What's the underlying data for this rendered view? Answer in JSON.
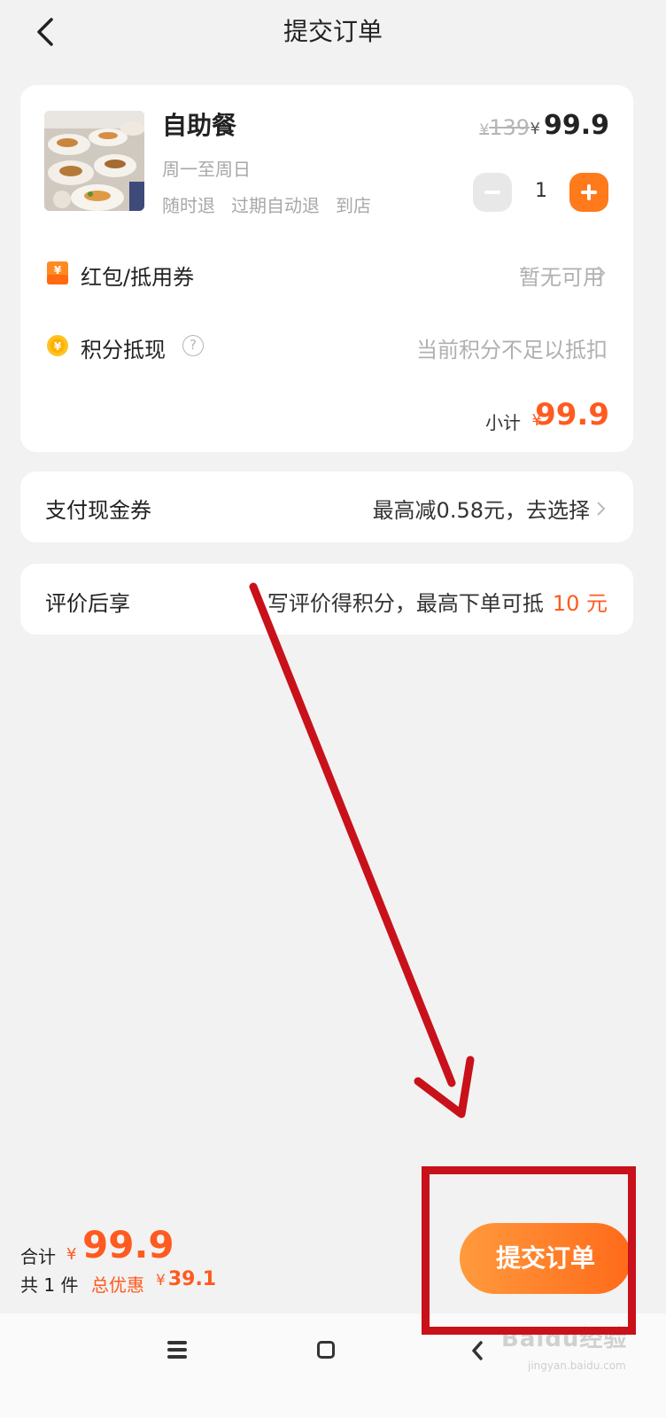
{
  "header": {
    "title": "提交订单",
    "back_icon": "chevron-left-icon"
  },
  "product": {
    "name": "自助餐",
    "days": "周一至周日",
    "tags": [
      "随时退",
      "过期自动退",
      "到店"
    ],
    "currency": "¥",
    "original_price": "139",
    "price": "99.9",
    "quantity": "1"
  },
  "coupon_row": {
    "label": "红包/抵用券",
    "value": "暂无可用",
    "icon": "coupon-icon"
  },
  "points_row": {
    "label": "积分抵现",
    "help": "?",
    "value": "当前积分不足以抵扣",
    "icon": "points-coin-icon"
  },
  "subtotal": {
    "label": "小计",
    "currency": "¥",
    "value": "99.9"
  },
  "cash_coupon": {
    "label": "支付现金券",
    "value": "最高减0.58元，去选择"
  },
  "review": {
    "label": "评价后享",
    "value": "写评价得积分，最高下单可抵",
    "amount": "10 元"
  },
  "footer": {
    "total_label": "合计",
    "currency": "¥",
    "total_value": "99.9",
    "count_text": "共 1 件",
    "discount_label": "总优惠",
    "discount_value": "39.1",
    "submit_label": "提交订单"
  },
  "annotation": {
    "color": "#c8111a"
  },
  "watermark": {
    "text": "Baidu经验",
    "sub": "jingyan.baidu.com"
  },
  "colors": {
    "accent": "#ff5a1f",
    "button": "#ff7a1a",
    "background": "#f2f2f2"
  }
}
